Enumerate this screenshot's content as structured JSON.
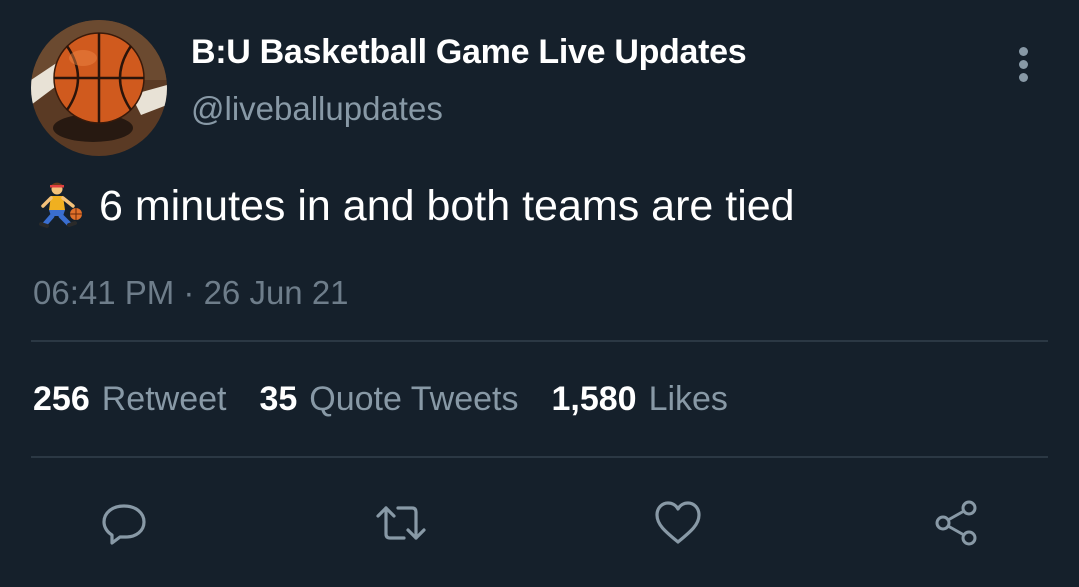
{
  "tweet": {
    "display_name": "B:U Basketball Game Live Updates",
    "handle": "@liveballupdates",
    "emoji": "person-bouncing-ball",
    "text": "6 minutes in and both teams are tied",
    "time": "06:41 PM",
    "separator": " · ",
    "date": "26 Jun 21",
    "avatar": "basketball-on-court"
  },
  "stats": {
    "retweets": {
      "count": "256",
      "label": "Retweet"
    },
    "quotes": {
      "count": "35",
      "label": "Quote Tweets"
    },
    "likes": {
      "count": "1,580",
      "label": "Likes"
    }
  },
  "actions": {
    "reply": "reply-icon",
    "retweet": "retweet-icon",
    "like": "heart-icon",
    "share": "share-icon"
  },
  "colors": {
    "background": "#15202b",
    "primary_text": "#ffffff",
    "secondary_text": "#8899a6",
    "divider": "#2b3844"
  }
}
